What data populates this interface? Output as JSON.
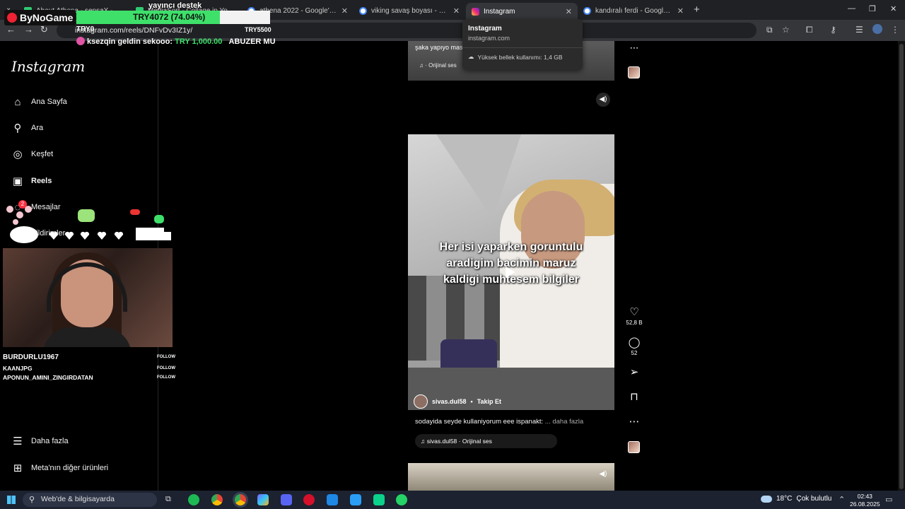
{
  "browser": {
    "tabs": [
      {
        "title": "About Athena - sensaX - Watch",
        "favicon": "check-icon"
      },
      {
        "title": "MediaSort - Collage in Your P...",
        "favicon": "check-icon"
      },
      {
        "title": "athena 2022 - Google'da Ara",
        "favicon": "google-icon"
      },
      {
        "title": "viking savaş boyası - Google'da",
        "favicon": "google-icon"
      },
      {
        "title": "Instagram",
        "favicon": "instagram-icon",
        "active": true
      },
      {
        "title": "kandıralı ferdi - Google'da Ara",
        "favicon": "google-icon"
      }
    ],
    "url": "instagram.com/reels/DNFvDv3IZ1y/",
    "hovercard": {
      "title": "Instagram",
      "site": "instagram.com",
      "memory": "Yüksek bellek kullanımı: 1,4 GB"
    }
  },
  "stream_overlay": {
    "brand": "ByNoGame",
    "donation_title": "yayıncı destek",
    "donation_progress_text": "TRY4072 (74.04%)",
    "donation_progress": 0.7404,
    "donation_min": "TRY0",
    "donation_max": "TRY5500",
    "ticker_message": "ksezqin geldin sekooo:",
    "ticker_amount": "TRY 1,000.00",
    "ticker_next": "ABUZER MU",
    "follows": [
      {
        "name": "BURDURLU1967",
        "tag": "FOLLOW"
      },
      {
        "name": "KAANJPG",
        "tag": "FOLLOW"
      },
      {
        "name": "APONUN_AMINI_ZINGIRDATAN",
        "tag": "FOLLOW"
      }
    ]
  },
  "sidebar": {
    "logo": "Instagram",
    "items": [
      {
        "label": "Ana Sayfa",
        "icon": "home-icon"
      },
      {
        "label": "Ara",
        "icon": "search-icon"
      },
      {
        "label": "Keşfet",
        "icon": "compass-icon"
      },
      {
        "label": "Reels",
        "icon": "reels-icon",
        "active": true
      },
      {
        "label": "Mesajlar",
        "icon": "messenger-icon",
        "badge": "2"
      },
      {
        "label": "Bildirimler",
        "icon": "heart-icon"
      }
    ],
    "more": "Daha fazla",
    "meta": "Meta'nın diğer ürünleri"
  },
  "reels": {
    "previous": {
      "caption": "şaka yapıyo mas",
      "audio": "· Orijinal ses"
    },
    "current": {
      "overlay_text": [
        "Her isi yaparken goruntulu",
        "aradigim bacimin maruz",
        "kaldigi muhtesem bilgiler"
      ],
      "author": "sivas.dul58",
      "follow": "Takip Et",
      "caption": "sodayida seyde kullaniyorum eee ispanakt:",
      "more": "... daha fazla",
      "audio": "sivas.dul58 · Orijinal ses",
      "likes": "52,8 B",
      "comments": "52"
    }
  },
  "taskbar": {
    "search_placeholder": "Web'de & bilgisayarda",
    "weather": "18°C",
    "weather_text": "Çok bulutlu",
    "time": "02:43",
    "date": "26.08.2025"
  }
}
